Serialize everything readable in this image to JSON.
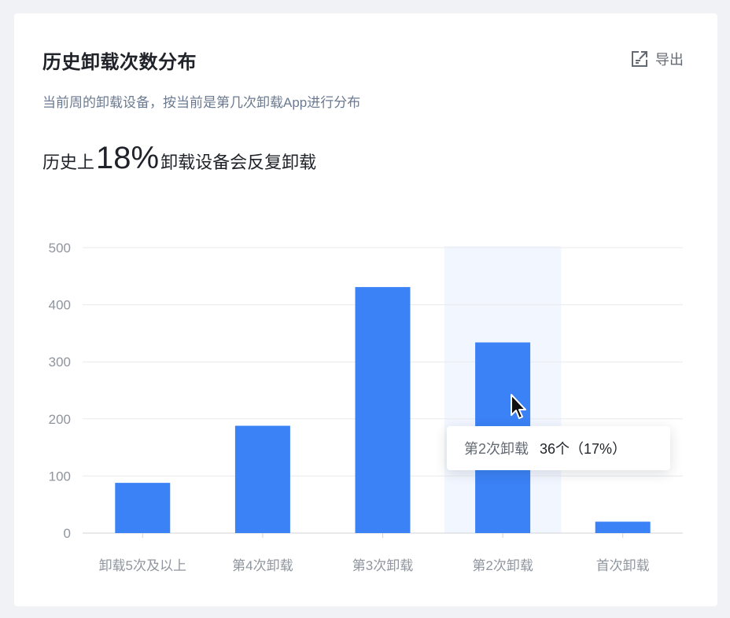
{
  "card": {
    "title": "历史卸载次数分布",
    "export_label": "导出",
    "subtitle": "当前周的卸载设备，按当前是第几次卸载App进行分布",
    "headline_prefix": "历史上",
    "headline_value": "18%",
    "headline_suffix": "卸载设备会反复卸载"
  },
  "tooltip": {
    "category": "第2次卸载",
    "value": "36个（17%）"
  },
  "colors": {
    "bar": "#3b82f6",
    "highlight_band": "#f2f6ff",
    "grid": "#e8eaed"
  },
  "chart_data": {
    "type": "bar",
    "categories": [
      "卸载5次及以上",
      "第4次卸载",
      "第3次卸载",
      "第2次卸载",
      "首次卸载"
    ],
    "values": [
      88,
      188,
      431,
      334,
      20
    ],
    "yticks": [
      0,
      100,
      200,
      300,
      400,
      500
    ],
    "ylim": [
      0,
      500
    ],
    "highlighted_category": "第2次卸载",
    "grid": true
  }
}
